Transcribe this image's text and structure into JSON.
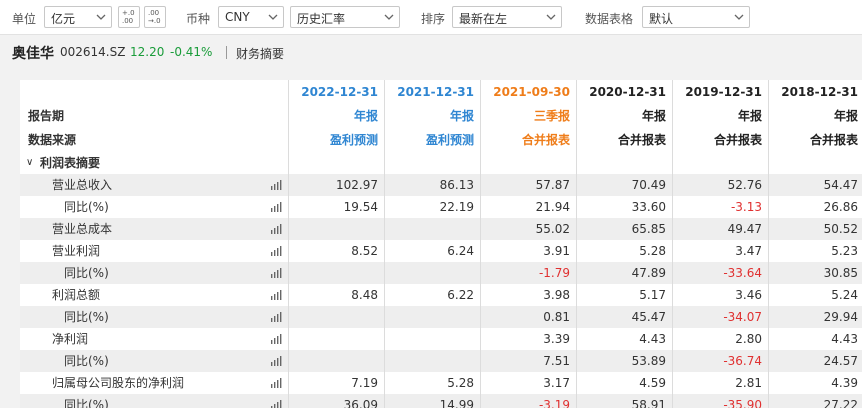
{
  "toolbar": {
    "unit_label": "单位",
    "unit_value": "亿元",
    "decimal_inc_top": "+.0",
    "decimal_inc_bottom": ".00",
    "decimal_dec_top": ".00",
    "decimal_dec_bottom": "→.0",
    "currency_label": "币种",
    "currency_value": "CNY",
    "rate_value": "历史汇率",
    "sort_label": "排序",
    "sort_value": "最新在左",
    "format_label": "数据表格",
    "format_value": "默认"
  },
  "stock": {
    "name": "奥佳华",
    "code": "002614.SZ",
    "price": "12.20",
    "change": "-0.41%",
    "tab": "财务摘要",
    "color_down": "#1a9c3a"
  },
  "header": {
    "row_report_period": "报告期",
    "row_data_source": "数据来源",
    "columns": [
      {
        "date": "2022-12-31",
        "type": "年报",
        "source": "盈利预测",
        "style": "blue"
      },
      {
        "date": "2021-12-31",
        "type": "年报",
        "source": "盈利预测",
        "style": "blue"
      },
      {
        "date": "2021-09-30",
        "type": "三季报",
        "source": "合并报表",
        "style": "orange"
      },
      {
        "date": "2020-12-31",
        "type": "年报",
        "source": "合并报表",
        "style": "dark"
      },
      {
        "date": "2019-12-31",
        "type": "年报",
        "source": "合并报表",
        "style": "dark"
      },
      {
        "date": "2018-12-31",
        "type": "年报",
        "source": "合并报表",
        "style": "dark"
      }
    ]
  },
  "section": {
    "title": "利润表摘要",
    "toggle_glyph": "∨"
  },
  "rows": [
    {
      "label": "营业总收入",
      "indent": 2,
      "values": [
        "102.97",
        "86.13",
        "57.87",
        "70.49",
        "52.76",
        "54.47"
      ]
    },
    {
      "label": "同比(%)",
      "indent": 3,
      "values": [
        "19.54",
        "22.19",
        "21.94",
        "33.60",
        "-3.13",
        "26.86"
      ]
    },
    {
      "label": "营业总成本",
      "indent": 2,
      "values": [
        "",
        "",
        "55.02",
        "65.85",
        "49.47",
        "50.52"
      ]
    },
    {
      "label": "营业利润",
      "indent": 2,
      "values": [
        "8.52",
        "6.24",
        "3.91",
        "5.28",
        "3.47",
        "5.23"
      ]
    },
    {
      "label": "同比(%)",
      "indent": 3,
      "values": [
        "",
        "",
        "-1.79",
        "47.89",
        "-33.64",
        "30.85"
      ]
    },
    {
      "label": "利润总额",
      "indent": 2,
      "values": [
        "8.48",
        "6.22",
        "3.98",
        "5.17",
        "3.46",
        "5.24"
      ]
    },
    {
      "label": "同比(%)",
      "indent": 3,
      "values": [
        "",
        "",
        "0.81",
        "45.47",
        "-34.07",
        "29.94"
      ]
    },
    {
      "label": "净利润",
      "indent": 2,
      "values": [
        "",
        "",
        "3.39",
        "4.43",
        "2.80",
        "4.43"
      ]
    },
    {
      "label": "同比(%)",
      "indent": 3,
      "values": [
        "",
        "",
        "7.51",
        "53.89",
        "-36.74",
        "24.57"
      ]
    },
    {
      "label": "归属母公司股东的净利润",
      "indent": 2,
      "values": [
        "7.19",
        "5.28",
        "3.17",
        "4.59",
        "2.81",
        "4.39"
      ]
    },
    {
      "label": "同比(%)",
      "indent": 3,
      "values": [
        "36.09",
        "14.99",
        "-3.19",
        "58.91",
        "-35.90",
        "27.22"
      ]
    }
  ],
  "colors": {
    "forecast_blue": "#2f86d2",
    "quarter_orange": "#ef7d1a",
    "negative_red": "#e03030"
  }
}
